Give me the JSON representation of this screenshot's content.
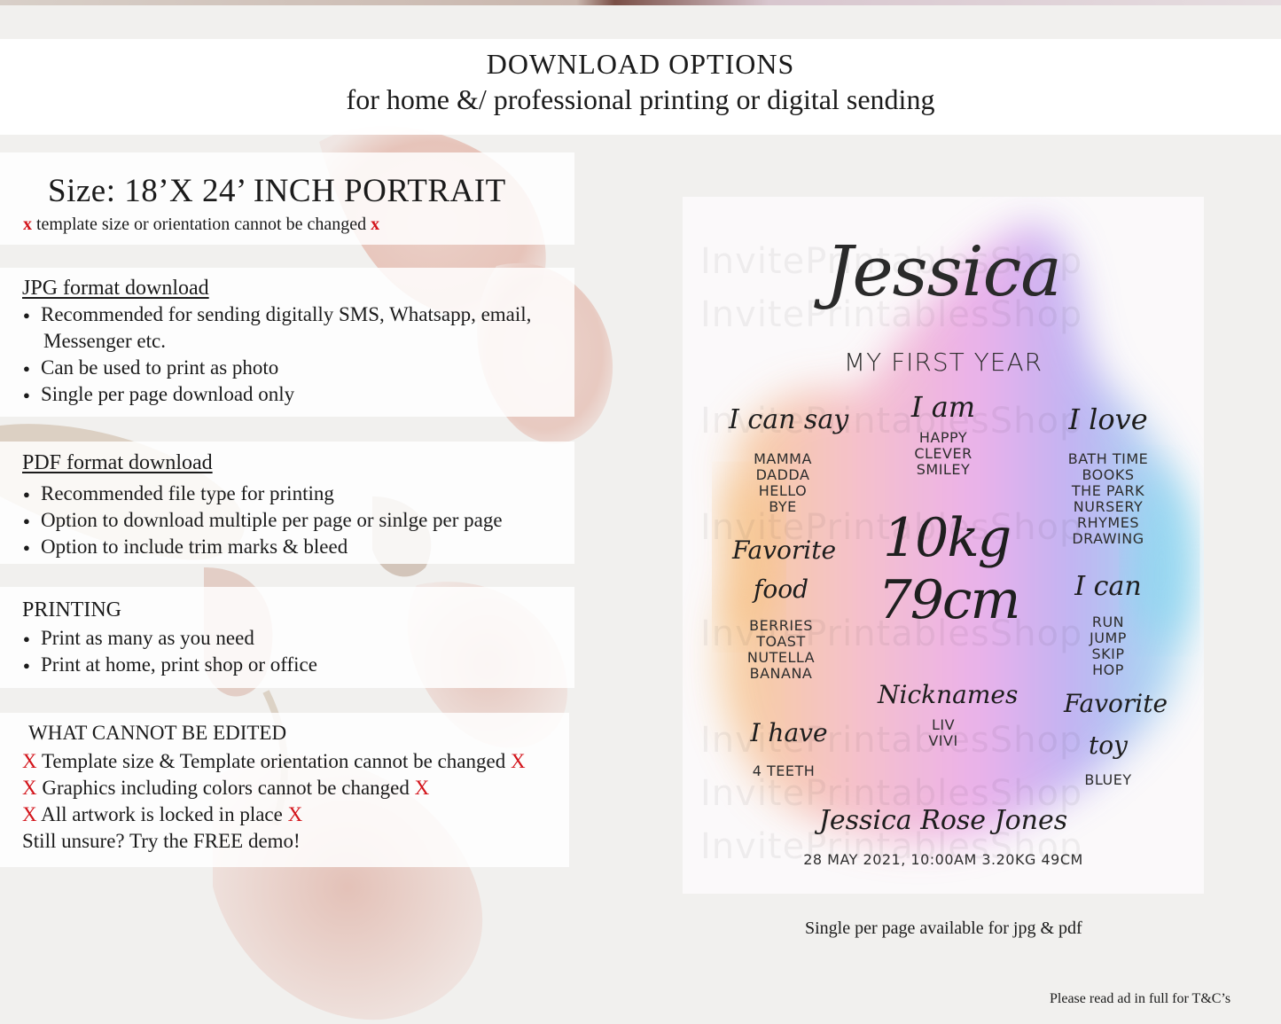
{
  "header": {
    "title": "DOWNLOAD OPTIONS",
    "subtitle": "for home &/ professional printing or digital sending"
  },
  "size": {
    "title": "Size: 18’X 24’ INCH PORTRAIT",
    "mark": "x",
    "note": "template size or orientation cannot be changed"
  },
  "jpg": {
    "heading": "JPG format download",
    "items": [
      "Recommended for sending digitally SMS, Whatsapp, email,",
      "Messenger etc.",
      "Can be used to print as photo",
      "Single per page download only"
    ]
  },
  "pdf": {
    "heading": "PDF format download",
    "items": [
      "Recommended file type for printing",
      "Option to download multiple per page or sinlge per page",
      "Option to include trim marks & bleed"
    ]
  },
  "printing": {
    "heading": "PRINTING",
    "items": [
      "Print as many as you need",
      "Print at home, print shop or office"
    ]
  },
  "edit": {
    "heading": "WHAT CANNOT BE EDITED",
    "mark": "X",
    "items": [
      "Template size & Template orientation cannot be changed",
      "Graphics including colors cannot be changed",
      "All artwork is locked in place"
    ],
    "demo": "Still unsure? Try the FREE demo!"
  },
  "poster": {
    "watermark": "InvitePrintablesShop",
    "name": "Jessica",
    "subtitle": "MY FIRST YEAR",
    "can_say": {
      "label": "I can say",
      "items": [
        "MAMMA",
        "DADDA",
        "HELLO",
        "BYE"
      ]
    },
    "i_am": {
      "label": "I am",
      "items": [
        "HAPPY",
        "CLEVER",
        "SMILEY"
      ]
    },
    "i_love": {
      "label": "I love",
      "items": [
        "BATH TIME",
        "BOOKS",
        "THE PARK",
        "NURSERY",
        "RHYMES",
        "DRAWING"
      ]
    },
    "weight": "10kg",
    "height": "79cm",
    "favorite_food": {
      "label1": "Favorite",
      "label2": "food",
      "items": [
        "BERRIES",
        "TOAST",
        "NUTELLA",
        "BANANA"
      ]
    },
    "i_can": {
      "label": "I can",
      "items": [
        "RUN",
        "JUMP",
        "SKIP",
        "HOP"
      ]
    },
    "nicknames": {
      "label": "Nicknames",
      "items": [
        "LIV",
        "VIVI"
      ]
    },
    "i_have": {
      "label": "I have",
      "items": [
        "4 TEETH"
      ]
    },
    "favorite_toy": {
      "label1": "Favorite",
      "label2": "toy",
      "items": [
        "BLUEY"
      ]
    },
    "full_name": "Jessica Rose Jones",
    "birth_details": "28 MAY 2021, 10:00AM 3.20KG 49CM"
  },
  "caption": "Single per page available for jpg & pdf",
  "footer": "Please read ad in full for T&C’s"
}
